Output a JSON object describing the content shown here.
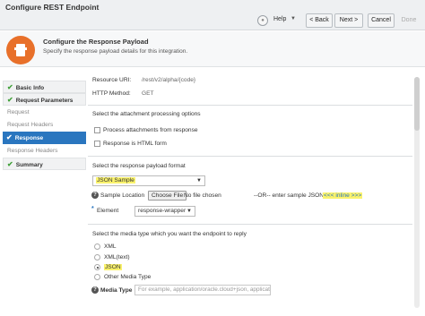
{
  "titlebar": {
    "title": "Configure REST Endpoint",
    "help_label": "Help",
    "back_label": "< Back",
    "next_label": "Next >",
    "cancel_label": "Cancel",
    "done_label": "Done"
  },
  "header": {
    "title": "Configure the Response Payload",
    "subtitle": "Specify the response payload details for this integration."
  },
  "sidebar": {
    "basic_info": "Basic Info",
    "request_parameters": "Request Parameters",
    "request": "Request",
    "request_headers": "Request Headers",
    "response": "Response",
    "response_headers": "Response Headers",
    "summary": "Summary"
  },
  "form": {
    "resource_uri_label": "Resource URI:",
    "resource_uri_value": "/rest/v2/alpha/{code}",
    "http_method_label": "HTTP Method:",
    "http_method_value": "GET",
    "attachment_title": "Select the attachment processing options",
    "process_attachments": "Process attachments from response",
    "response_html": "Response is HTML form",
    "payload_format_title": "Select the response payload format",
    "payload_format_value": "JSON Sample",
    "sample_location_label": "Sample Location",
    "choose_file": "Choose File",
    "no_file": "No file chosen",
    "or_enter": "--OR-- enter sample JSON",
    "inline_link": "<<< inline >>>",
    "element_label": "Element",
    "element_value": "response-wrapper",
    "media_type_title": "Select the media type which you want the endpoint to reply",
    "media_options": [
      "XML",
      "XML(text)",
      "JSON",
      "Other Media Type"
    ],
    "selected_media": "JSON",
    "media_type_label": "Media Type",
    "media_type_placeholder": "For example, application/oracle.cloud+json, applicatio"
  }
}
